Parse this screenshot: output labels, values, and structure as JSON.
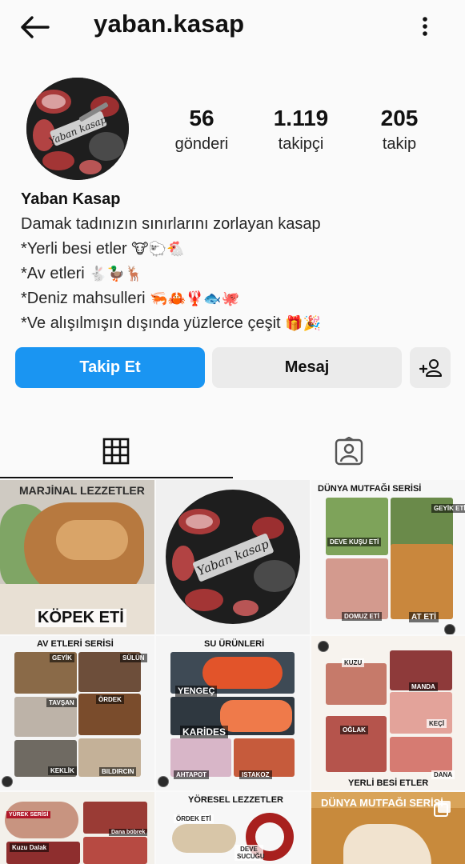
{
  "header": {
    "username": "yaban.kasap"
  },
  "avatar": {
    "logo_text": "Yaban kasap"
  },
  "stats": {
    "posts": {
      "value": "56",
      "label": "gönderi"
    },
    "followers": {
      "value": "1.119",
      "label": "takipçi"
    },
    "following": {
      "value": "205",
      "label": "takip"
    }
  },
  "bio": {
    "name": "Yaban Kasap",
    "lines": [
      {
        "text": "Damak tadınızın sınırlarını zorlayan kasap",
        "emoji": ""
      },
      {
        "text": "*Yerli besi etler",
        "emoji": "🐮🐑🐔"
      },
      {
        "text": "*Av etleri",
        "emoji": "🐇🦆🦌"
      },
      {
        "text": "*Deniz mahsulleri",
        "emoji": "🦐🦀🦞🐟🐙"
      },
      {
        "text": "*Ve alışılmışın dışında yüzlerce çeşit",
        "emoji": "🎁🎉"
      }
    ]
  },
  "actions": {
    "follow_label": "Takip Et",
    "message_label": "Mesaj"
  },
  "tabs": [
    {
      "icon": "grid-icon",
      "active": true
    },
    {
      "icon": "tagged-person-icon",
      "active": false
    }
  ],
  "posts": {
    "p1": {
      "title": "MARJİNAL LEZZETLER",
      "caption": "KÖPEK ETİ"
    },
    "p2": {
      "logo_text": "Yaban kasap"
    },
    "p3": {
      "title": "DÜNYA MUTFAĞI SERİSİ",
      "tags": [
        "GEYİK ETİ",
        "DEVE KUŞU ETİ",
        "DOMUZ ETİ",
        "AT ETİ"
      ]
    },
    "p4": {
      "title": "AV ETLERİ SERİSİ",
      "tags": [
        "GEYİK",
        "SÜLÜN",
        "TAVŞAN",
        "ÖRDEK",
        "KEKLİK",
        "BILDIRCIN"
      ]
    },
    "p5": {
      "title": "SU ÜRÜNLERİ",
      "tags": [
        "YENGEÇ",
        "KARİDES",
        "AHTAPOT",
        "ISTAKOZ"
      ]
    },
    "p6": {
      "tags": [
        "KUZU",
        "MANDA",
        "OĞLAK",
        "KEÇİ",
        "DANA"
      ],
      "caption": "YERLİ BESİ ETLER"
    },
    "p7": {
      "tags": [
        "YÜREK SERİSİ",
        "Dana böbrek",
        "Kuzu Dalak"
      ]
    },
    "p8": {
      "title": "YÖRESEL LEZZETLER",
      "tags": [
        "ÖRDEK ETİ",
        "DEVE SUCUĞU"
      ]
    },
    "p9": {
      "title": "DÜNYA MUTFAĞI SERİSİ"
    }
  },
  "colors": {
    "follow_button": "#1a95f2",
    "secondary_button": "#ebebeb",
    "background": "#fafafa"
  }
}
